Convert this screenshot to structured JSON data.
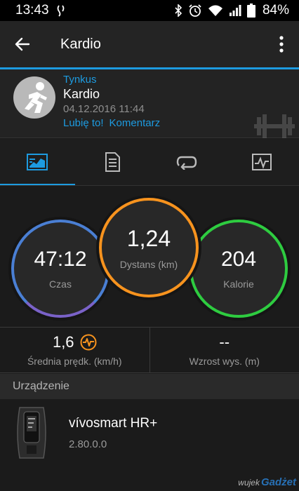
{
  "status_bar": {
    "time": "13:43",
    "battery_percent": "84%",
    "icons": [
      "sync-icon",
      "bluetooth-icon",
      "alarm-icon",
      "wifi-icon",
      "signal-icon",
      "battery-icon"
    ]
  },
  "app_bar": {
    "title": "Kardio"
  },
  "activity": {
    "type_label": "Tynkus",
    "name": "Kardio",
    "date": "04.12.2016 11:44",
    "like_label": "Lubię to!",
    "comment_label": "Komentarz"
  },
  "tabs": [
    {
      "icon": "summary-icon",
      "selected": true
    },
    {
      "icon": "details-icon",
      "selected": false
    },
    {
      "icon": "laps-icon",
      "selected": false
    },
    {
      "icon": "chart-icon",
      "selected": false
    }
  ],
  "stats": {
    "time": {
      "value": "47:12",
      "label": "Czas"
    },
    "distance": {
      "value": "1,24",
      "label": "Dystans (km)"
    },
    "calories": {
      "value": "204",
      "label": "Kalorie"
    }
  },
  "summary": {
    "avg_speed": {
      "value": "1,6",
      "label": "Średnia prędk. (km/h)"
    },
    "elevation_gain": {
      "value": "--",
      "label": "Wzrost wys. (m)"
    }
  },
  "device_section": {
    "header": "Urządzenie",
    "device_name": "vívosmart HR+",
    "firmware": "2.80.0.0"
  },
  "watermark": {
    "part1": "wujek",
    "part2": "Gadżet"
  },
  "colors": {
    "accent": "#1d9be0",
    "time_ring": "#4a7fd4",
    "distance_ring": "#f7931e",
    "calories_ring": "#2ecc40"
  }
}
